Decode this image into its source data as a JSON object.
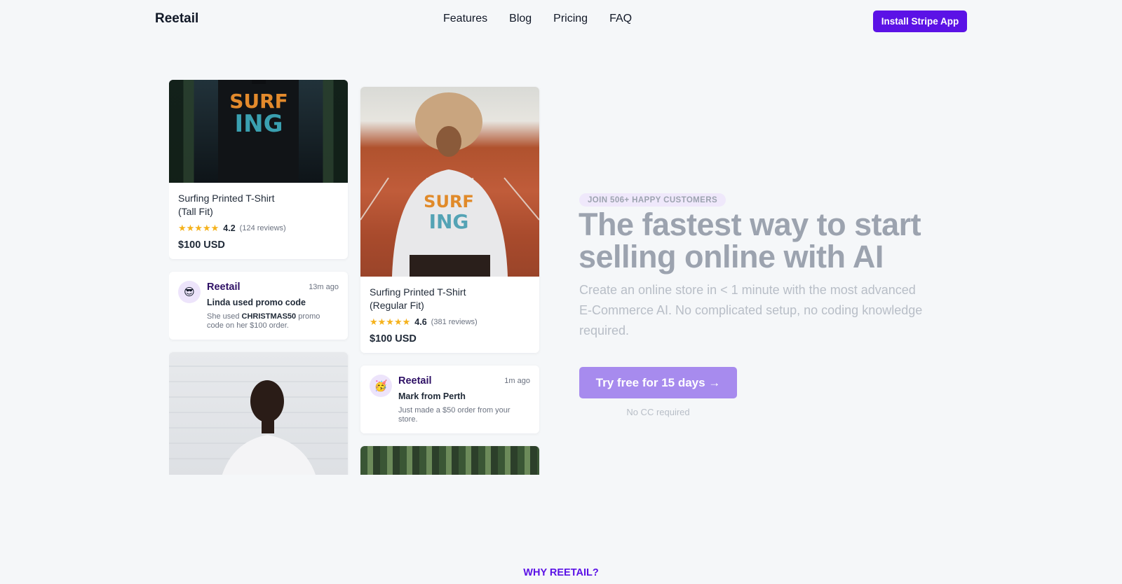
{
  "nav": {
    "logo": "Reetail",
    "links": [
      "Features",
      "Blog",
      "Pricing",
      "FAQ"
    ],
    "cta": "Install Stripe App"
  },
  "products": [
    {
      "title_line1": "Surfing Printed T-Shirt",
      "title_line2": "(Tall Fit)",
      "stars": "★★★★★",
      "rating": "4.2",
      "reviews": "(124 reviews)",
      "price": "$100 USD"
    },
    {
      "title_line1": "Surfing Printed T-Shirt",
      "title_line2": "(Regular Fit)",
      "stars": "★★★★★",
      "rating": "4.6",
      "reviews": "(381 reviews)",
      "price": "$100 USD"
    }
  ],
  "notifications": [
    {
      "avatar": "😎",
      "name": "Reetail",
      "time": "13m ago",
      "headline": "Linda used promo code",
      "desc_pre": "She used ",
      "desc_code": "CHRISTMAS50",
      "desc_post": " promo code on her $100 order."
    },
    {
      "avatar": "🥳",
      "name": "Reetail",
      "time": "1m ago",
      "headline": "Mark from Perth",
      "desc": "Just made a $50 order from your store."
    }
  ],
  "hero": {
    "badge": "JOIN 506+ HAPPY CUSTOMERS",
    "headline": "The fastest way to start selling online with AI",
    "subtext": "Create an online store in < 1 minute with the most advanced E-Commerce AI. No complicated setup, no coding knowledge required.",
    "cta": "Try free for 15 days →",
    "note": "No CC required"
  },
  "section": {
    "label": "WHY REETAIL?"
  },
  "colors": {
    "brand": "#5b12e6",
    "cta_light": "#a78bee",
    "star": "#f5b21c",
    "page_bg": "#f5f7f9"
  }
}
